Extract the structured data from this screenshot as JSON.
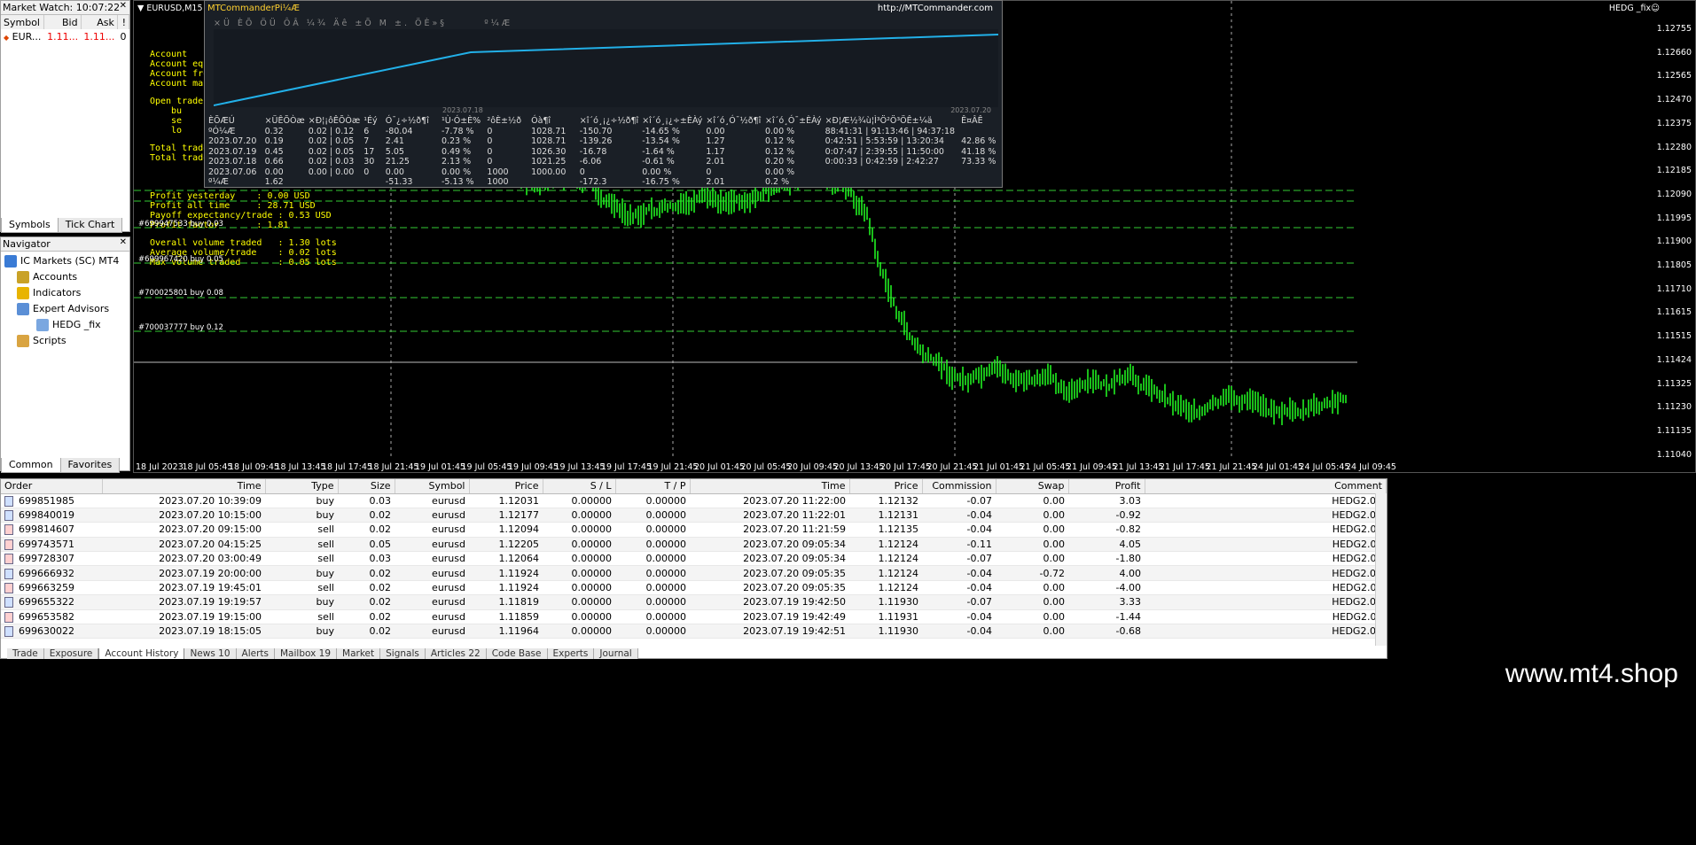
{
  "market_watch": {
    "title": "Market Watch: 10:07:22",
    "cols": [
      "Symbol",
      "Bid",
      "Ask",
      "!"
    ],
    "row": {
      "symbol": "EUR...",
      "bid": "1.11...",
      "ask": "1.11...",
      "spread": "0"
    },
    "tabs": [
      "Symbols",
      "Tick Chart"
    ]
  },
  "navigator": {
    "title": "Navigator",
    "root": "IC Markets (SC) MT4",
    "items": [
      "Accounts",
      "Indicators",
      "Expert Advisors",
      "HEDG _fix",
      "Scripts"
    ],
    "tabs": [
      "Common",
      "Favorites"
    ]
  },
  "chart": {
    "title": "EURUSD,M15",
    "ea_name": "HEDG _fix☺",
    "y_labels": [
      "1.12755",
      "1.12660",
      "1.12565",
      "1.12470",
      "1.12375",
      "1.12280",
      "1.12185",
      "1.12090",
      "1.11995",
      "1.11900",
      "1.11805",
      "1.11710",
      "1.11615",
      "1.11515",
      "1.11424",
      "1.11325",
      "1.11230",
      "1.11135",
      "1.11040"
    ],
    "x_labels": [
      "18 Jul 2023",
      "18 Jul 05:45",
      "18 Jul 09:45",
      "18 Jul 13:45",
      "18 Jul 17:45",
      "18 Jul 21:45",
      "19 Jul 01:45",
      "19 Jul 05:45",
      "19 Jul 09:45",
      "19 Jul 13:45",
      "19 Jul 17:45",
      "19 Jul 21:45",
      "20 Jul 01:45",
      "20 Jul 05:45",
      "20 Jul 09:45",
      "20 Jul 13:45",
      "20 Jul 17:45",
      "20 Jul 21:45",
      "21 Jul 01:45",
      "21 Jul 05:45",
      "21 Jul 09:45",
      "21 Jul 13:45",
      "21 Jul 17:45",
      "21 Jul 21:45",
      "24 Jul 01:45",
      "24 Jul 05:45",
      "24 Jul 09:45"
    ],
    "ea_text": [
      "Account",
      "Account equ",
      "Account fre",
      "Account mar",
      "Open trades",
      "bu",
      "se",
      "lo",
      "Total trade",
      "Total trade",
      "Profit yesterday    : 0.00 USD",
      "Profit all time     : 28.71 USD",
      "Payoff expectancy/trade : 0.53 USD",
      "Profit factor       : 1.81",
      "Overall volume traded   : 1.30 lots",
      "Average volume/trade    : 0.02 lots",
      "Max volume traded       : 0.05 lots"
    ],
    "order_lines": [
      "#700025801 buy 0.08",
      "#700037777 buy 0.12",
      "#699967420 buy 0.05",
      "#699947533 buy 0.03"
    ]
  },
  "mtc": {
    "title": "MTCommanderPі¼Æ",
    "url": "http://MTCommander.com",
    "date_start": "2023.07.18",
    "date_end": "2023.07.20",
    "headers": [
      "ÈÕÆÚ",
      "×ÜÊÕÒæ",
      "×Ð¦¡ôÊÕÒæ",
      "¹Éý",
      "Ó¯¿÷½ð¶î",
      "¹Ù·Ó±È%",
      "²ôÈ±½ð",
      "Óà¶î",
      "×î´ó¸¡¿÷½ð¶î",
      "×î´ó¸¡¿÷±ÈÀý",
      "×î´ó¸Ó¯½ð¶î",
      "×î´ó¸Ó¯±ÈÀý",
      "×Ð¦Æ½¾ù¦Ì³Ö²Ö³ÖÊ±¼ä",
      "Ê¤ÂÊ"
    ],
    "rows": [
      [
        "ºÓ¼Æ",
        "0.32",
        "0.02 | 0.12",
        "6",
        "-80.04",
        "-7.78 %",
        "0",
        "1028.71",
        "-150.70",
        "-14.65 %",
        "0.00",
        "0.00 %",
        "88:41:31 | 91:13:46 | 94:37:18",
        ""
      ],
      [
        "2023.07.20",
        "0.19",
        "0.02 | 0.05",
        "7",
        "2.41",
        "0.23 %",
        "0",
        "1028.71",
        "-139.26",
        "-13.54 %",
        "1.27",
        "0.12 %",
        "0:42:51 | 5:53:59 | 13:20:34",
        "42.86 %"
      ],
      [
        "2023.07.19",
        "0.45",
        "0.02 | 0.05",
        "17",
        "5.05",
        "0.49 %",
        "0",
        "1026.30",
        "-16.78",
        "-1.64 %",
        "1.17",
        "0.12 %",
        "0:07:47 | 2:39:55 | 11:50:00",
        "41.18 %"
      ],
      [
        "2023.07.18",
        "0.66",
        "0.02 | 0.03",
        "30",
        "21.25",
        "2.13 %",
        "0",
        "1021.25",
        "-6.06",
        "-0.61 %",
        "2.01",
        "0.20 %",
        "0:00:33 | 0:42:59 | 2:42:27",
        "73.33 %"
      ],
      [
        "2023.07.06",
        "0.00",
        "0.00 | 0.00",
        "0",
        "0.00",
        "0.00 %",
        "1000",
        "1000.00",
        "0",
        "0.00 %",
        "0",
        "0.00 %",
        "",
        ""
      ],
      [
        "º¼Æ",
        "1.62",
        "",
        "",
        "-51.33",
        "-5.13 %",
        "1000",
        "",
        "-172.3",
        "-16.75 %",
        "2.01",
        "0.2 %",
        "",
        ""
      ]
    ]
  },
  "terminal": {
    "cols": [
      "Order",
      "Time",
      "Type",
      "Size",
      "Symbol",
      "Price",
      "S / L",
      "T / P",
      "Time",
      "Price",
      "Commission",
      "Swap",
      "Profit",
      "Comment"
    ],
    "rows": [
      [
        "699851985",
        "2023.07.20 10:39:09",
        "buy",
        "0.03",
        "eurusd",
        "1.12031",
        "0.00000",
        "0.00000",
        "2023.07.20 11:22:00",
        "1.12132",
        "-0.07",
        "0.00",
        "3.03",
        "HEDG2.0B"
      ],
      [
        "699840019",
        "2023.07.20 10:15:00",
        "buy",
        "0.02",
        "eurusd",
        "1.12177",
        "0.00000",
        "0.00000",
        "2023.07.20 11:22:01",
        "1.12131",
        "-0.04",
        "0.00",
        "-0.92",
        "HEDG2.0B"
      ],
      [
        "699814607",
        "2023.07.20 09:15:00",
        "sell",
        "0.02",
        "eurusd",
        "1.12094",
        "0.00000",
        "0.00000",
        "2023.07.20 11:21:59",
        "1.12135",
        "-0.04",
        "0.00",
        "-0.82",
        "HEDG2.0S"
      ],
      [
        "699743571",
        "2023.07.20 04:15:25",
        "sell",
        "0.05",
        "eurusd",
        "1.12205",
        "0.00000",
        "0.00000",
        "2023.07.20 09:05:34",
        "1.12124",
        "-0.11",
        "0.00",
        "4.05",
        "HEDG2.0S"
      ],
      [
        "699728307",
        "2023.07.20 03:00:49",
        "sell",
        "0.03",
        "eurusd",
        "1.12064",
        "0.00000",
        "0.00000",
        "2023.07.20 09:05:34",
        "1.12124",
        "-0.07",
        "0.00",
        "-1.80",
        "HEDG2.0S"
      ],
      [
        "699666932",
        "2023.07.19 20:00:00",
        "buy",
        "0.02",
        "eurusd",
        "1.11924",
        "0.00000",
        "0.00000",
        "2023.07.20 09:05:35",
        "1.12124",
        "-0.04",
        "-0.72",
        "4.00",
        "HEDG2.0B"
      ],
      [
        "699663259",
        "2023.07.19 19:45:01",
        "sell",
        "0.02",
        "eurusd",
        "1.11924",
        "0.00000",
        "0.00000",
        "2023.07.20 09:05:35",
        "1.12124",
        "-0.04",
        "0.00",
        "-4.00",
        "HEDG2.0S"
      ],
      [
        "699655322",
        "2023.07.19 19:19:57",
        "buy",
        "0.02",
        "eurusd",
        "1.11819",
        "0.00000",
        "0.00000",
        "2023.07.19 19:42:50",
        "1.11930",
        "-0.07",
        "0.00",
        "3.33",
        "HEDG2.0B"
      ],
      [
        "699653582",
        "2023.07.19 19:15:00",
        "sell",
        "0.02",
        "eurusd",
        "1.11859",
        "0.00000",
        "0.00000",
        "2023.07.19 19:42:49",
        "1.11931",
        "-0.04",
        "0.00",
        "-1.44",
        "HEDG2.0S"
      ],
      [
        "699630022",
        "2023.07.19 18:15:05",
        "buy",
        "0.02",
        "eurusd",
        "1.11964",
        "0.00000",
        "0.00000",
        "2023.07.19 19:42:51",
        "1.11930",
        "-0.04",
        "0.00",
        "-0.68",
        "HEDG2.0B"
      ]
    ],
    "tabs": [
      "Trade",
      "Exposure",
      "Account History",
      "News 10",
      "Alerts",
      "Mailbox 19",
      "Market",
      "Signals",
      "Articles 22",
      "Code Base",
      "Experts",
      "Journal"
    ]
  },
  "watermark": "www.mt4.shop"
}
